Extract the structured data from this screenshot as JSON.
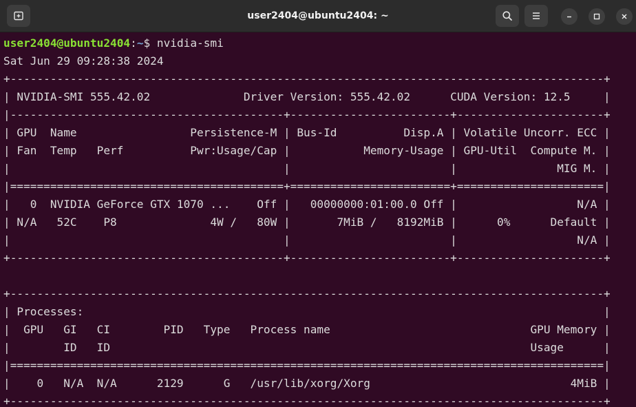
{
  "window": {
    "title": "user2404@ubuntu2404: ~",
    "icons": {
      "new_tab": "new-tab-icon",
      "search": "search-icon",
      "menu": "hamburger-menu-icon",
      "minimize": "minimize-icon",
      "maximize": "maximize-icon",
      "close": "close-icon"
    }
  },
  "terminal": {
    "prompt": {
      "user_host": "user2404@ubuntu2404",
      "sep": ":",
      "path": "~",
      "symbol": "$ ",
      "command": "nvidia-smi"
    },
    "lines": [
      "Sat Jun 29 09:28:38 2024",
      "+-----------------------------------------------------------------------------------------+",
      "| NVIDIA-SMI 555.42.02              Driver Version: 555.42.02      CUDA Version: 12.5     |",
      "|-----------------------------------------+------------------------+----------------------+",
      "| GPU  Name                 Persistence-M | Bus-Id          Disp.A | Volatile Uncorr. ECC |",
      "| Fan  Temp   Perf          Pwr:Usage/Cap |           Memory-Usage | GPU-Util  Compute M. |",
      "|                                         |                        |               MIG M. |",
      "|=========================================+========================+======================|",
      "|   0  NVIDIA GeForce GTX 1070 ...    Off |   00000000:01:00.0 Off |                  N/A |",
      "| N/A   52C    P8              4W /   80W |       7MiB /   8192MiB |      0%      Default |",
      "|                                         |                        |                  N/A |",
      "+-----------------------------------------+------------------------+----------------------+",
      "",
      "+-----------------------------------------------------------------------------------------+",
      "| Processes:                                                                              |",
      "|  GPU   GI   CI        PID   Type   Process name                              GPU Memory |",
      "|        ID   ID                                                               Usage      |",
      "|=========================================================================================|",
      "|    0   N/A  N/A      2129      G   /usr/lib/xorg/Xorg                              4MiB |",
      "+-----------------------------------------------------------------------------------------+"
    ]
  },
  "colors": {
    "terminal_bg": "#300a24",
    "prompt_user": "#8ae234",
    "prompt_path": "#729fcf",
    "text": "#dcdcdc",
    "titlebar_bg": "#2c2c2c"
  }
}
